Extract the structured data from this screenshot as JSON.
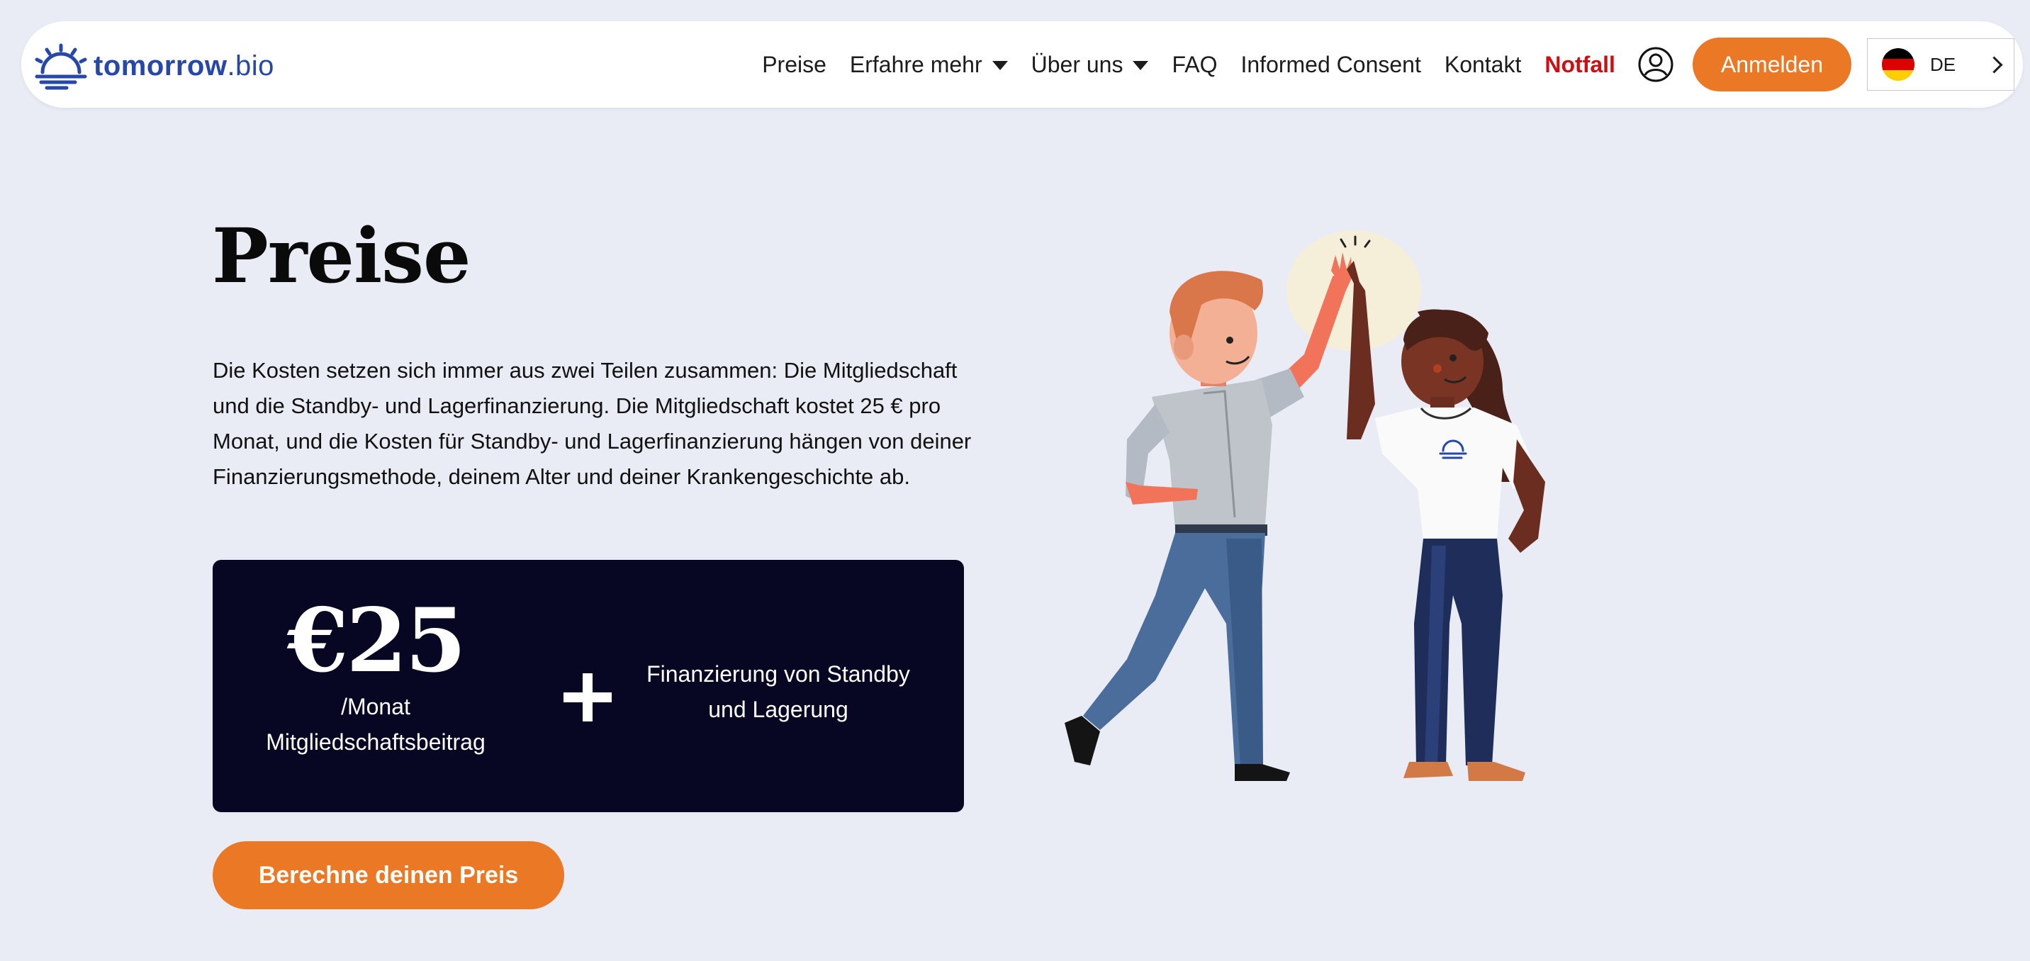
{
  "brand": {
    "name_bold": "tomorrow",
    "name_light": ".bio",
    "logo_icon": "sunrise-icon",
    "primary_color": "#2748a8"
  },
  "nav": {
    "items": [
      {
        "label": "Preise",
        "dropdown": false
      },
      {
        "label": "Erfahre mehr",
        "dropdown": true
      },
      {
        "label": "Über uns",
        "dropdown": true
      },
      {
        "label": "FAQ",
        "dropdown": false
      },
      {
        "label": "Informed Consent",
        "dropdown": false
      },
      {
        "label": "Kontakt",
        "dropdown": false
      },
      {
        "label": "Notfall",
        "dropdown": false,
        "color": "#cc0f12"
      }
    ],
    "account_icon": "user-circle-icon",
    "login_label": "Anmelden",
    "login_color": "#ea7825",
    "language": {
      "code": "DE",
      "flag": "germany-flag-icon"
    }
  },
  "hero": {
    "title": "Preise",
    "intro": "Die Kosten setzen sich immer aus zwei Teilen zusammen: Die Mitgliedschaft und die Standby- und Lagerfinanzierung. Die Mitgliedschaft kostet 25 € pro Monat, und die Kosten für Standby- und Lagerfinanzierung hängen von deiner Finanzierungsmethode, deinem Alter und deiner Krankengeschichte ab.",
    "price_card": {
      "amount": "€25",
      "period": "/Monat",
      "label": "Mitgliedschaftsbeitrag",
      "plus_icon": "plus-icon",
      "right_text": "Finanzierung von Standby und Lagerung",
      "background": "#070623"
    },
    "cta_label": "Berechne deinen Preis",
    "illustration": "two-people-high-five-illustration"
  },
  "colors": {
    "page_background": "#e9ecf4",
    "accent": "#ea7825"
  }
}
